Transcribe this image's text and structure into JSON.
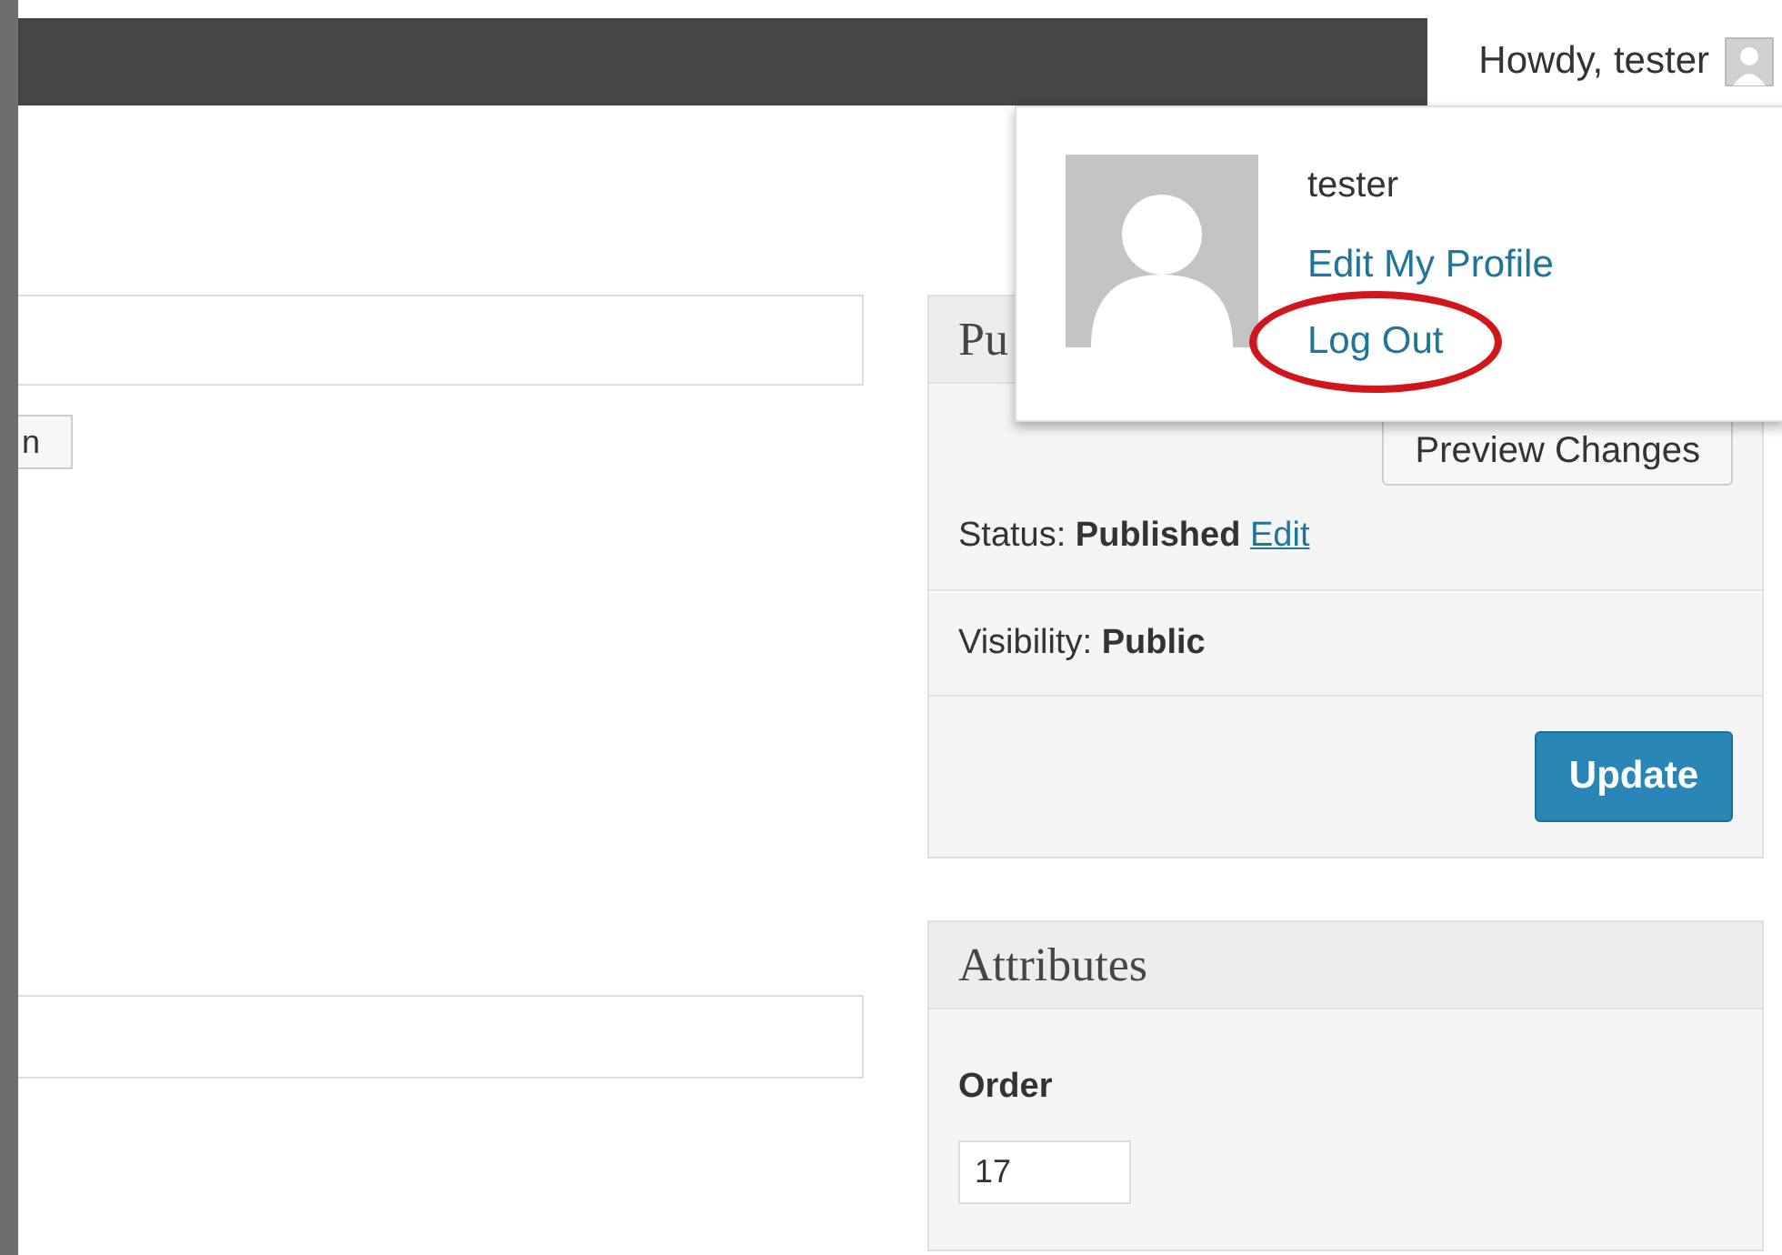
{
  "top_bar": {
    "greeting": "Howdy, tester"
  },
  "account_menu": {
    "username": "tester",
    "links": [
      {
        "label": "Edit My Profile",
        "circled": false
      },
      {
        "label": "Log Out",
        "circled": true
      }
    ]
  },
  "editor": {
    "button": "n"
  },
  "publish_box": {
    "title": "Pu",
    "preview_button": "Preview Changes",
    "status": "Status: **Published**",
    "status_link": "Edit",
    "visibility": "Visibility: **Public**",
    "update_button": "Update"
  },
  "attributes_box": {
    "title": "Attributes",
    "order_label": "Order",
    "order_value": "17"
  }
}
